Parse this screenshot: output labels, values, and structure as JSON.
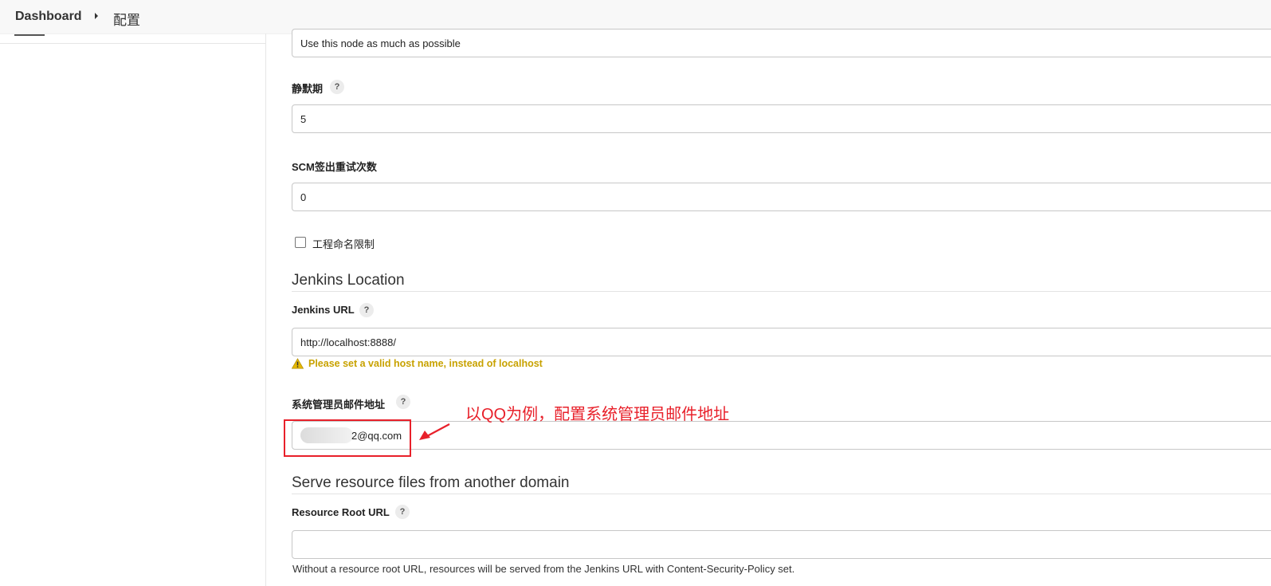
{
  "breadcrumb": {
    "dashboard": "Dashboard",
    "current": "配置"
  },
  "usage": {
    "value": "Use this node as much as possible"
  },
  "quiet_period": {
    "label": "静默期",
    "help": "?",
    "value": "5"
  },
  "scm_retry": {
    "label": "SCM签出重试次数",
    "value": "0"
  },
  "project_naming": {
    "label": "工程命名限制",
    "checked": false
  },
  "jenkins_location": {
    "title": "Jenkins Location",
    "url_label": "Jenkins URL",
    "help": "?",
    "url_value": "http://localhost:8888/",
    "warning": "Please set a valid host name, instead of localhost",
    "admin_email_label": "系统管理员邮件地址",
    "admin_email_help": "?",
    "admin_email_value": "2@qq.com"
  },
  "resource_domain": {
    "title": "Serve resource files from another domain",
    "root_url_label": "Resource Root URL",
    "help": "?",
    "root_url_value": "",
    "description": "Without a resource root URL, resources will be served from the Jenkins URL with Content-Security-Policy set."
  },
  "annotation": {
    "text": "以QQ为例，配置系统管理员邮件地址",
    "color": "#e8202a"
  },
  "colors": {
    "warning": "#c8a200",
    "annotation": "#e8202a"
  }
}
